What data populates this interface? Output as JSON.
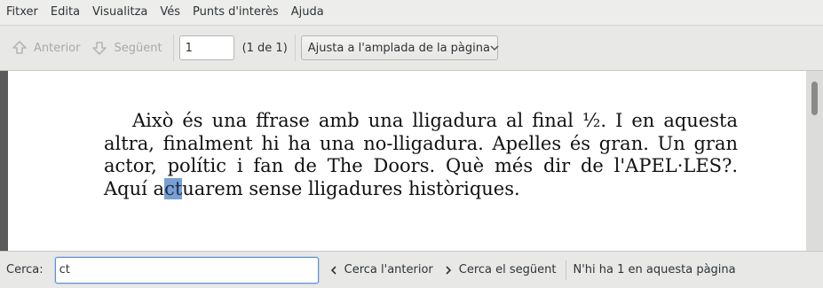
{
  "menubar": {
    "items": [
      "Fitxer",
      "Edita",
      "Visualitza",
      "Vés",
      "Punts d'interès",
      "Ajuda"
    ]
  },
  "toolbar": {
    "prev_label": "Anterior",
    "next_label": "Següent",
    "page_value": "1",
    "page_count": "(1 de 1)",
    "zoom_value": "Ajusta a l'amplada de la pàgina"
  },
  "document": {
    "lines": [
      "Això és una ffrase amb una lligadura al final ½. I en aquesta",
      "altra, finalment hi ha una no-lligadura. Apelles és gran. Un gran",
      "actor, polític i fan de The Doors. Què més dir de l'APEL·LES?.",
      "Aquí ",
      "ct",
      "uarem sense lligadures històriques."
    ]
  },
  "findbar": {
    "label": "Cerca:",
    "query": "ct",
    "prev_label": "Cerca l'anterior",
    "next_label": "Cerca el següent",
    "status": "N'hi ha 1 en aquesta pàgina"
  }
}
